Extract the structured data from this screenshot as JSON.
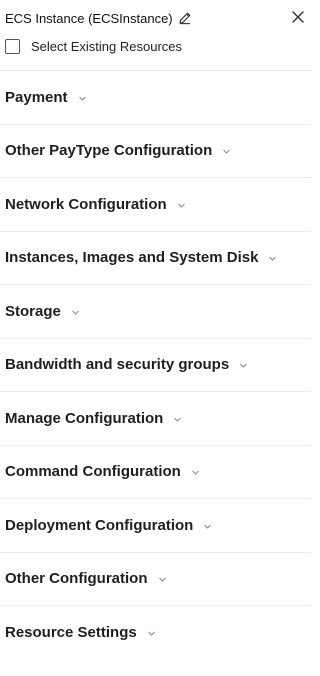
{
  "header": {
    "title": "ECS Instance (ECSInstance)",
    "select_existing_label": "Select Existing Resources",
    "icons": {
      "edit": "pencil-icon",
      "close": "close-icon"
    }
  },
  "sections": [
    {
      "label": "Payment"
    },
    {
      "label": "Other PayType Configuration"
    },
    {
      "label": "Network Configuration"
    },
    {
      "label": "Instances, Images and System Disk"
    },
    {
      "label": "Storage"
    },
    {
      "label": "Bandwidth and security groups"
    },
    {
      "label": "Manage Configuration"
    },
    {
      "label": "Command Configuration"
    },
    {
      "label": "Deployment Configuration"
    },
    {
      "label": "Other Configuration"
    },
    {
      "label": "Resource Settings"
    }
  ],
  "colors": {
    "text": "#1f1f1f",
    "divider": "#ececec",
    "chevron": "#8c8c8c"
  }
}
